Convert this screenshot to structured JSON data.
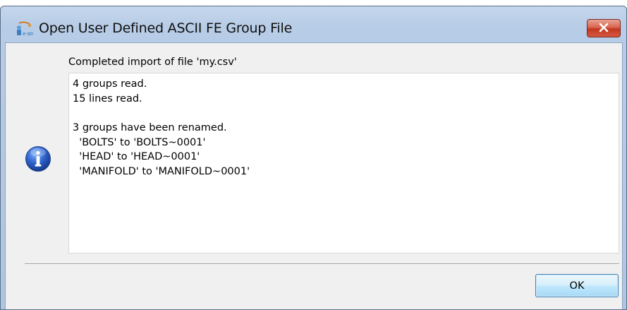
{
  "window": {
    "title": "Open User Defined ASCII FE Group File",
    "icon": "app-logo-icon",
    "close_icon": "close-icon"
  },
  "dialog": {
    "headline": "Completed import of file 'my.csv'",
    "message_lines": [
      "4 groups read.",
      "15 lines read.",
      "",
      "3 groups have been renamed.",
      "  'BOLTS' to 'BOLTS~0001'",
      "  'HEAD' to 'HEAD~0001'",
      "  'MANIFOLD' to 'MANIFOLD~0001'"
    ],
    "status_icon": "info-icon",
    "ok_label": "OK"
  },
  "colors": {
    "titlebar": "#b7cce6",
    "close_button": "#c3371f",
    "info_blue": "#1f4fb5",
    "ok_button": "#bee6fd"
  }
}
